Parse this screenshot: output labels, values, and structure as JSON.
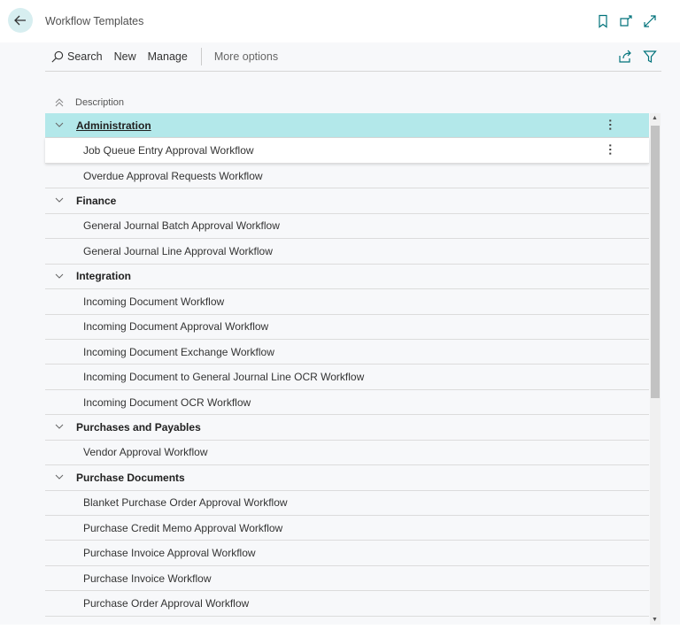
{
  "header": {
    "title": "Workflow Templates"
  },
  "toolbar": {
    "search": "Search",
    "new": "New",
    "manage": "Manage",
    "more": "More options"
  },
  "list": {
    "column": "Description",
    "rows": [
      {
        "type": "group",
        "label": "Administration"
      },
      {
        "type": "item",
        "label": "Job Queue Entry Approval Workflow"
      },
      {
        "type": "item",
        "label": "Overdue Approval Requests Workflow"
      },
      {
        "type": "group",
        "label": "Finance"
      },
      {
        "type": "item",
        "label": "General Journal Batch Approval Workflow"
      },
      {
        "type": "item",
        "label": "General Journal Line Approval Workflow"
      },
      {
        "type": "group",
        "label": "Integration"
      },
      {
        "type": "item",
        "label": "Incoming Document Workflow"
      },
      {
        "type": "item",
        "label": "Incoming Document Approval Workflow"
      },
      {
        "type": "item",
        "label": "Incoming Document Exchange Workflow"
      },
      {
        "type": "item",
        "label": "Incoming Document to General Journal Line OCR Workflow"
      },
      {
        "type": "item",
        "label": "Incoming Document OCR Workflow"
      },
      {
        "type": "group",
        "label": "Purchases and Payables"
      },
      {
        "type": "item",
        "label": "Vendor Approval Workflow"
      },
      {
        "type": "group",
        "label": "Purchase Documents"
      },
      {
        "type": "item",
        "label": "Blanket Purchase Order Approval Workflow"
      },
      {
        "type": "item",
        "label": "Purchase Credit Memo Approval Workflow"
      },
      {
        "type": "item",
        "label": "Purchase Invoice Approval Workflow"
      },
      {
        "type": "item",
        "label": "Purchase Invoice Workflow"
      },
      {
        "type": "item",
        "label": "Purchase Order Approval Workflow"
      }
    ]
  },
  "colors": {
    "accent": "#00727a",
    "selected": "#b3e8ea"
  }
}
